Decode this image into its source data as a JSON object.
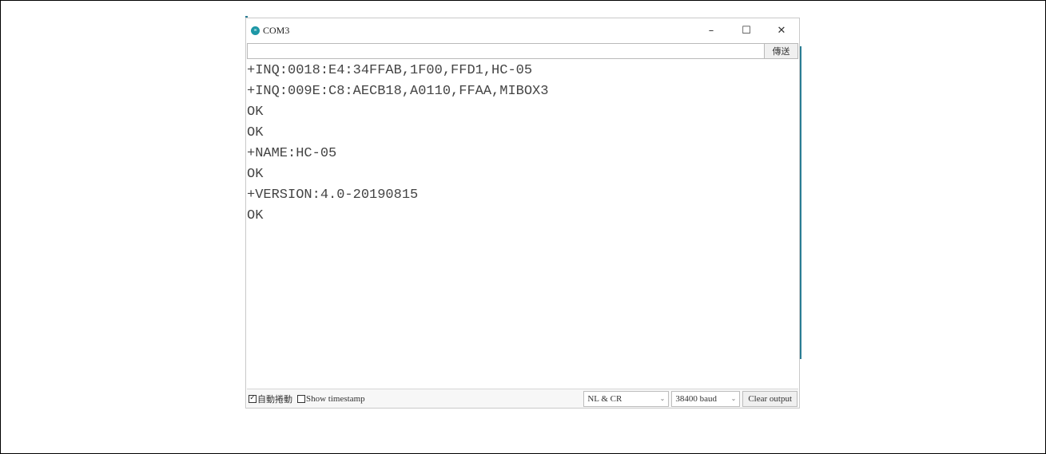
{
  "window": {
    "title": "COM3",
    "app_icon_text": "∞",
    "controls": {
      "minimize": "–",
      "maximize": "☐",
      "close": "✕"
    }
  },
  "input": {
    "value": "",
    "placeholder": "",
    "send_label": "傳送"
  },
  "output": {
    "lines": [
      "+INQ:0018:E4:34FFAB,1F00,FFD1,HC-05",
      "+INQ:009E:C8:AECB18,A0110,FFAA,MIBOX3",
      "OK",
      "OK",
      "+NAME:HC-05",
      "OK",
      "+VERSION:4.0-20190815",
      "OK"
    ]
  },
  "statusbar": {
    "autoscroll": {
      "label": "自動捲動",
      "checked": true,
      "mark": "✓"
    },
    "timestamp": {
      "label": "Show timestamp",
      "checked": false,
      "mark": ""
    },
    "line_ending": "NL & CR",
    "baud": "38400 baud",
    "dropdown_icon": "chevron-down-icon",
    "chevron": "⌄",
    "clear_label": "Clear output"
  },
  "colors": {
    "accent": "#2a7d94",
    "icon": "#1d97a6"
  }
}
